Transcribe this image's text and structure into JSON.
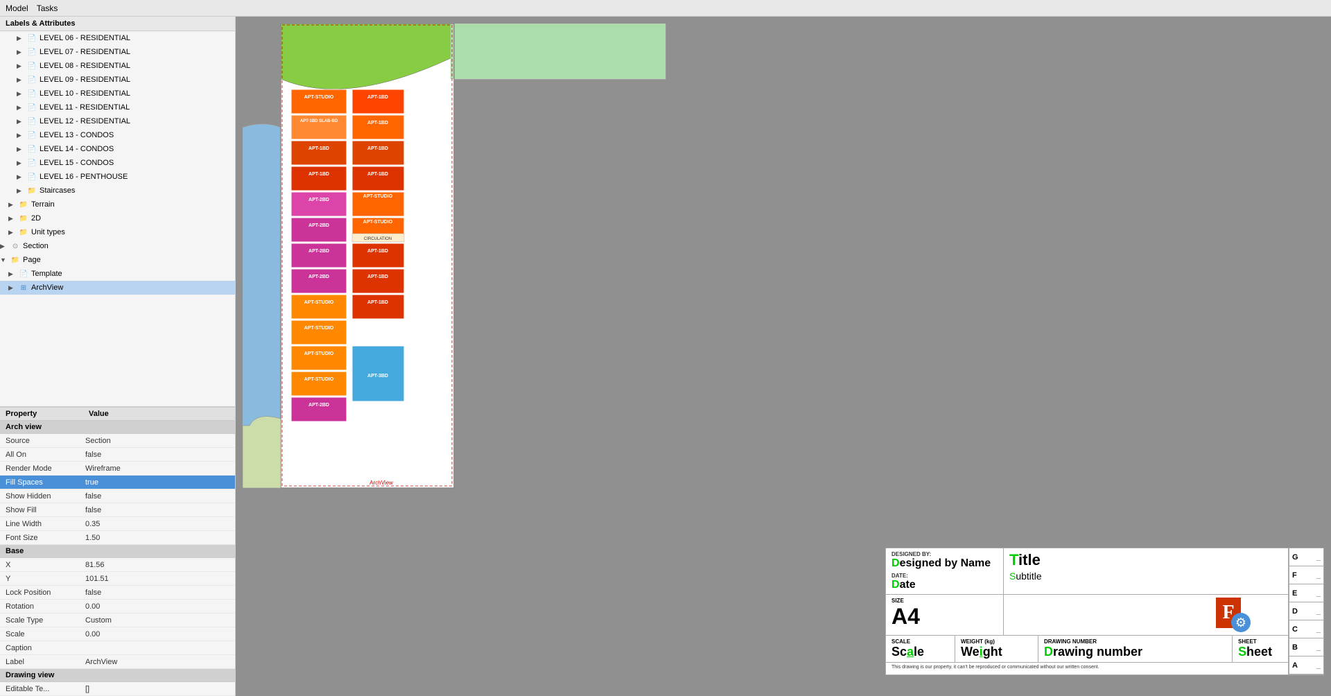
{
  "menuBar": {
    "items": [
      "Model",
      "Tasks"
    ]
  },
  "leftPanel": {
    "labelsHeader": "Labels & Attributes",
    "treeItems": [
      {
        "id": "level06",
        "label": "LEVEL 06 - RESIDENTIAL",
        "indent": 2,
        "type": "doc",
        "expanded": false
      },
      {
        "id": "level07",
        "label": "LEVEL 07 - RESIDENTIAL",
        "indent": 2,
        "type": "doc",
        "expanded": false
      },
      {
        "id": "level08",
        "label": "LEVEL 08 - RESIDENTIAL",
        "indent": 2,
        "type": "doc",
        "expanded": false
      },
      {
        "id": "level09",
        "label": "LEVEL 09 - RESIDENTIAL",
        "indent": 2,
        "type": "doc",
        "expanded": false
      },
      {
        "id": "level10",
        "label": "LEVEL 10 - RESIDENTIAL",
        "indent": 2,
        "type": "doc",
        "expanded": false
      },
      {
        "id": "level11",
        "label": "LEVEL 11 - RESIDENTIAL",
        "indent": 2,
        "type": "doc",
        "expanded": false
      },
      {
        "id": "level12",
        "label": "LEVEL 12 - RESIDENTIAL",
        "indent": 2,
        "type": "doc",
        "expanded": false
      },
      {
        "id": "level13",
        "label": "LEVEL 13 - CONDOS",
        "indent": 2,
        "type": "doc",
        "expanded": false
      },
      {
        "id": "level14",
        "label": "LEVEL 14 - CONDOS",
        "indent": 2,
        "type": "doc",
        "expanded": false
      },
      {
        "id": "level15",
        "label": "LEVEL 15 - CONDOS",
        "indent": 2,
        "type": "doc",
        "expanded": false
      },
      {
        "id": "level16",
        "label": "LEVEL 16 - PENTHOUSE",
        "indent": 2,
        "type": "doc",
        "expanded": false
      },
      {
        "id": "staircases",
        "label": "Staircases",
        "indent": 2,
        "type": "folder",
        "expanded": false
      },
      {
        "id": "terrain",
        "label": "Terrain",
        "indent": 1,
        "type": "folder",
        "expanded": false
      },
      {
        "id": "2d",
        "label": "2D",
        "indent": 1,
        "type": "folder",
        "expanded": false
      },
      {
        "id": "unittypes",
        "label": "Unit types",
        "indent": 1,
        "type": "folder",
        "expanded": false
      },
      {
        "id": "section",
        "label": "Section",
        "indent": 0,
        "type": "section",
        "expanded": false
      },
      {
        "id": "page",
        "label": "Page",
        "indent": 0,
        "type": "folder",
        "expanded": true
      },
      {
        "id": "template",
        "label": "Template",
        "indent": 1,
        "type": "doc",
        "expanded": false
      },
      {
        "id": "archview",
        "label": "ArchView",
        "indent": 1,
        "type": "archview",
        "expanded": false,
        "selected": true
      }
    ],
    "propsHeader": {
      "property": "Property",
      "value": "Value"
    },
    "groups": [
      {
        "label": "Arch view",
        "rows": [
          {
            "name": "Source",
            "value": "Section",
            "highlight": false
          },
          {
            "name": "All On",
            "value": "false",
            "highlight": false
          },
          {
            "name": "Render Mode",
            "value": "Wireframe",
            "highlight": false
          },
          {
            "name": "Fill Spaces",
            "value": "true",
            "highlight": true
          },
          {
            "name": "Show Hidden",
            "value": "false",
            "highlight": false
          },
          {
            "name": "Show Fill",
            "value": "false",
            "highlight": false
          },
          {
            "name": "Line Width",
            "value": "0.35",
            "highlight": false
          },
          {
            "name": "Font Size",
            "value": "1.50",
            "highlight": false
          }
        ]
      },
      {
        "label": "Base",
        "rows": [
          {
            "name": "X",
            "value": "81.56",
            "highlight": false
          },
          {
            "name": "Y",
            "value": "101.51",
            "highlight": false
          },
          {
            "name": "Lock Position",
            "value": "false",
            "highlight": false
          },
          {
            "name": "Rotation",
            "value": "0.00",
            "highlight": false
          },
          {
            "name": "Scale Type",
            "value": "Custom",
            "highlight": false
          },
          {
            "name": "Scale",
            "value": "0.00",
            "highlight": false
          },
          {
            "name": "Caption",
            "value": "",
            "highlight": false
          },
          {
            "name": "Label",
            "value": "ArchView",
            "highlight": false
          }
        ]
      },
      {
        "label": "Drawing view",
        "rows": [
          {
            "name": "Editable Te...",
            "value": "[]",
            "highlight": false
          }
        ]
      }
    ]
  },
  "titleBlock": {
    "designedByLabel": "DESIGNED BY:",
    "designedByValue": "Designed by Name",
    "titleLabel": "Title",
    "subtitleLabel": "Subtitle",
    "dateLabel": "DATE:",
    "dateValue": "Date",
    "sizeLabel": "SIZE",
    "sizeValue": "A4",
    "scaleLabel": "SCALE",
    "scaleValue": "Scale",
    "weightLabel": "WEIGHT (kg)",
    "weightValue": "Weight",
    "drawingLabel": "DRAWING NUMBER",
    "drawingValue": "Drawing number",
    "sheetLabel": "SHEET",
    "sheetValue": "Sheet",
    "revisions": [
      {
        "letter": "G",
        "value": "_"
      },
      {
        "letter": "F",
        "value": "_"
      },
      {
        "letter": "E",
        "value": "_"
      },
      {
        "letter": "D",
        "value": "_"
      },
      {
        "letter": "C",
        "value": "_"
      },
      {
        "letter": "B",
        "value": "_"
      },
      {
        "letter": "A",
        "value": "_"
      }
    ],
    "disclaimer": "This drawing is our property, it can't be reproduced or communicated without our written consent."
  },
  "canvas": {
    "buildingLabel": "ArchView"
  }
}
